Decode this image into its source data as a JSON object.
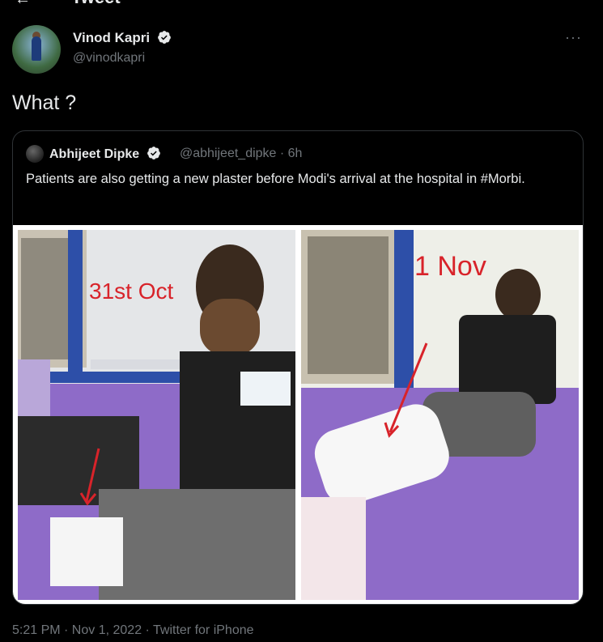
{
  "header": {
    "title": "Tweet"
  },
  "tweet": {
    "author_name": "Vinod Kapri",
    "author_handle": "@vinodkapri",
    "text": "What ?",
    "more_label": "···"
  },
  "quote": {
    "author_name": "Abhijeet Dipke",
    "author_handle": "@abhijeet_dipke · 6h",
    "text": "Patients are also getting a new plaster before Modi's arrival at the hospital in #Morbi.",
    "image": {
      "left_caption": "31st Oct",
      "right_caption": "1 Nov"
    }
  },
  "footer": {
    "meta": "5:21 PM · Nov 1, 2022 · Twitter for iPhone"
  },
  "colors": {
    "background": "#000000",
    "text": "#e7e9ea",
    "secondary": "#71767b",
    "verified": "#e7e9ea",
    "caption_red": "#d8232a"
  }
}
